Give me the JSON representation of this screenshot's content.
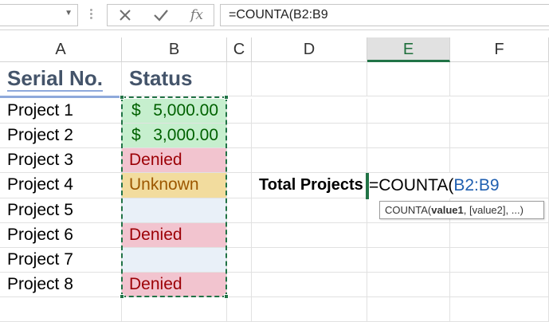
{
  "formula_bar": {
    "name_box_value": "",
    "formula_text": "=COUNTA(B2:B9"
  },
  "columns": [
    "A",
    "B",
    "C",
    "D",
    "E",
    "F"
  ],
  "selected_column": "E",
  "headers": {
    "serial": "Serial No.",
    "status": "Status"
  },
  "rows": [
    {
      "serial": "Project 1",
      "status_symbol": "$",
      "status_amount": "5,000.00",
      "status_type": "currency"
    },
    {
      "serial": "Project 2",
      "status_symbol": "$",
      "status_amount": "3,000.00",
      "status_type": "currency"
    },
    {
      "serial": "Project 3",
      "status": "Denied",
      "status_type": "denied"
    },
    {
      "serial": "Project 4",
      "status": "Unknown",
      "status_type": "unknown"
    },
    {
      "serial": "Project 5",
      "status": "",
      "status_type": "blank"
    },
    {
      "serial": "Project 6",
      "status": "Denied",
      "status_type": "denied"
    },
    {
      "serial": "Project 7",
      "status": "",
      "status_type": "blank"
    },
    {
      "serial": "Project 8",
      "status": "Denied",
      "status_type": "denied"
    }
  ],
  "label": {
    "total_projects": "Total Projects"
  },
  "edit_cell": {
    "func": "=COUNTA(",
    "range": "B2:B9"
  },
  "tooltip": {
    "func": "COUNTA(",
    "arg1": "value1",
    "rest": ", [value2], ...)"
  },
  "colors": {
    "excel_green": "#217346",
    "currency_fill": "#c6efce",
    "currency_text": "#006100",
    "denied_fill": "#f2c4cf",
    "denied_text": "#9c0006",
    "unknown_fill": "#f2dc9e",
    "unknown_text": "#9c5700",
    "header_text": "#44546a",
    "range_ref": "#1f5fb0"
  }
}
